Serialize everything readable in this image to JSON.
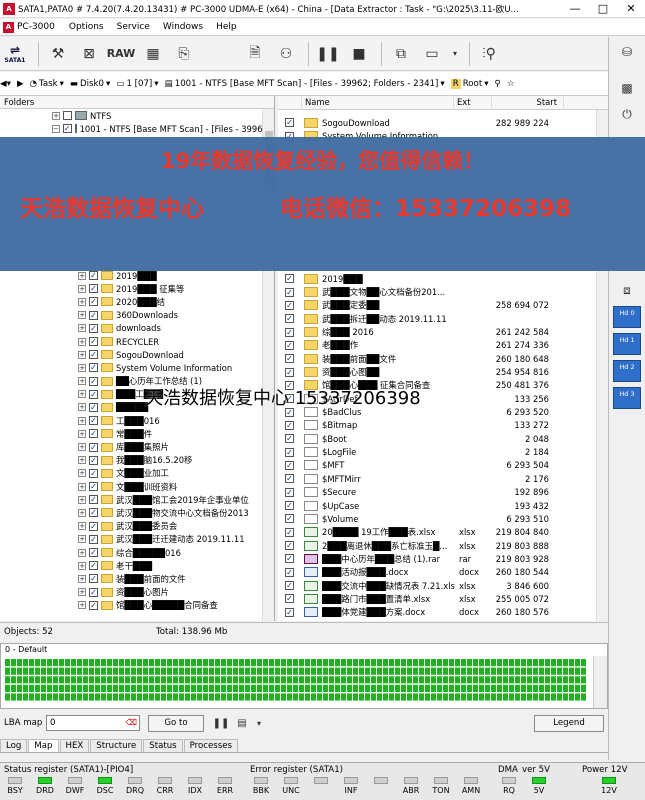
{
  "window": {
    "title": "SATA1,PATA0 # 7.4.20(7.4.20.13431) # PC-3000 UDMA-E (x64) - China - [Data Extractor : Task - \"G:\\2025\\3.11-欧U...",
    "minimize": "—",
    "maximize": "□",
    "close": "✕"
  },
  "menu": {
    "logo": "PC-3000",
    "items": [
      "Options",
      "Service",
      "Windows",
      "Help"
    ]
  },
  "toolbar": {
    "sata_label": "SATA1",
    "raw_label": "RAW"
  },
  "pathbar": {
    "task": "Task",
    "disk": "Disk0",
    "part_num": "1 [07]",
    "path": "1001 - NTFS [Base MFT Scan] - [Files - 39962; Folders - 2341]",
    "root": "Root"
  },
  "left_pane": {
    "header": "Folders",
    "tree_top": [
      {
        "indent": 52,
        "expander": "+",
        "checked": false,
        "icon": "drive",
        "label": "NTFS"
      },
      {
        "indent": 52,
        "expander": "−",
        "checked": true,
        "icon": "drive",
        "label": "1001 - NTFS [Base MFT Scan] - [Files - 39962"
      }
    ],
    "tree": [
      {
        "label": "2019███"
      },
      {
        "label": "2019███ 征集等"
      },
      {
        "label": "2020███结"
      },
      {
        "label": "360Downloads"
      },
      {
        "label": "downloads"
      },
      {
        "label": "RECYCLER"
      },
      {
        "label": "SogouDownload"
      },
      {
        "label": "System Volume Information"
      },
      {
        "label": "██心历年工作总结 (1)"
      },
      {
        "label": "███工███"
      },
      {
        "label": "█████"
      },
      {
        "label": "工███016"
      },
      {
        "label": "常███件"
      },
      {
        "label": "库███集照片"
      },
      {
        "label": "我███脑16.5.20移"
      },
      {
        "label": "文███业加工"
      },
      {
        "label": "文███训班资料"
      },
      {
        "label": "武汉███馆工会2019年企事业单位"
      },
      {
        "label": "武汉███物交流中心文档备份2013"
      },
      {
        "label": "武汉███委员会"
      },
      {
        "label": "武汉███迁迁建动态 2019.11.11"
      },
      {
        "label": "综合█████016"
      },
      {
        "label": "老干███"
      },
      {
        "label": "装███前面的文件"
      },
      {
        "label": "资███心图片"
      },
      {
        "label": "馆███心█████合同备查"
      }
    ]
  },
  "right_pane": {
    "col_name": "Name",
    "col_ext": "Ext",
    "col_start": "Start",
    "rows_top": [
      {
        "icon": "folder",
        "name": "SogouDownload",
        "ext": "",
        "start": "282 989 224"
      },
      {
        "icon": "folder",
        "name": "System Volume Information",
        "ext": "",
        "start": ""
      }
    ],
    "rows": [
      {
        "icon": "folder",
        "name": "2019███",
        "ext": "",
        "start": ""
      },
      {
        "icon": "folder",
        "name": "武███文物██心文档备份201...",
        "ext": "",
        "start": ""
      },
      {
        "icon": "folder",
        "name": "武███定委██",
        "ext": "",
        "start": "258 694 072"
      },
      {
        "icon": "folder",
        "name": "武███拆迁██动态 2019.11.11",
        "ext": "",
        "start": ""
      },
      {
        "icon": "folder",
        "name": "综███ 2016",
        "ext": "",
        "start": "261 242 584"
      },
      {
        "icon": "folder",
        "name": "老███作",
        "ext": "",
        "start": "261 274 336"
      },
      {
        "icon": "folder",
        "name": "装███前面██文件",
        "ext": "",
        "start": "260 180 648"
      },
      {
        "icon": "folder",
        "name": "资███心图██",
        "ext": "",
        "start": "254 954 816"
      },
      {
        "icon": "folder",
        "name": "馆███心███ 征集合同备查",
        "ext": "",
        "start": "250 481 376"
      },
      {
        "icon": "file",
        "name": "$AttrDef",
        "ext": "",
        "start": "133 256"
      },
      {
        "icon": "file",
        "name": "$BadClus",
        "ext": "",
        "start": "6 293 520"
      },
      {
        "icon": "file",
        "name": "$Bitmap",
        "ext": "",
        "start": "133 272"
      },
      {
        "icon": "file",
        "name": "$Boot",
        "ext": "",
        "start": "2 048"
      },
      {
        "icon": "file",
        "name": "$LogFile",
        "ext": "",
        "start": "2 184"
      },
      {
        "icon": "file",
        "name": "$MFT",
        "ext": "",
        "start": "6 293 504"
      },
      {
        "icon": "file",
        "name": "$MFTMirr",
        "ext": "",
        "start": "2 176"
      },
      {
        "icon": "file",
        "name": "$Secure",
        "ext": "",
        "start": "192 896"
      },
      {
        "icon": "file",
        "name": "$UpCase",
        "ext": "",
        "start": "193 432"
      },
      {
        "icon": "file",
        "name": "$Volume",
        "ext": "",
        "start": "6 293 510"
      },
      {
        "icon": "xls",
        "name": "20████ 19工作███表.xlsx",
        "ext": "xlsx",
        "start": "219 804 840"
      },
      {
        "icon": "xls",
        "name": "2███离退休███系亡标准玉█...",
        "ext": "xlsx",
        "start": "219 803 888"
      },
      {
        "icon": "rar",
        "name": "███中心历年███总结 (1).rar",
        "ext": "rar",
        "start": "219 803 928"
      },
      {
        "icon": "doc",
        "name": "███活动报███.docx",
        "ext": "docx",
        "start": "260 180 544"
      },
      {
        "icon": "xls",
        "name": "███交流中███缺情况表 7.21.xlsx",
        "ext": "xlsx",
        "start": "3 846 600"
      },
      {
        "icon": "xls",
        "name": "███路门市███置清单.xlsx",
        "ext": "xlsx",
        "start": "255 005 072"
      },
      {
        "icon": "doc",
        "name": "███体党建███方案.docx",
        "ext": "docx",
        "start": "260 180 576"
      }
    ]
  },
  "status": {
    "objects": "Objects: 52",
    "total": "Total: 138.96 Mb"
  },
  "map": {
    "title": "0 - Default"
  },
  "lba": {
    "label": "LBA map",
    "value": "0",
    "goto": "Go to",
    "legend": "Legend"
  },
  "tabs": [
    "Log",
    "Map",
    "HEX",
    "Structure",
    "Status",
    "Processes"
  ],
  "active_tab": "Map",
  "registers": {
    "status_title": "Status register (SATA1)-[PIO4]",
    "error_title": "Error register (SATA1)",
    "dma_title": "DMA",
    "ver_title": "ver 5V",
    "power_title": "Power 12V",
    "status_bits": [
      {
        "label": "BSY",
        "on": false
      },
      {
        "label": "DRD",
        "on": true
      },
      {
        "label": "DWF",
        "on": false
      },
      {
        "label": "DSC",
        "on": true
      },
      {
        "label": "DRQ",
        "on": false
      },
      {
        "label": "CRR",
        "on": false
      },
      {
        "label": "IDX",
        "on": false
      },
      {
        "label": "ERR",
        "on": false
      }
    ],
    "error_bits": [
      {
        "label": "BBK",
        "on": false
      },
      {
        "label": "UNC",
        "on": false
      },
      {
        "label": "",
        "on": false
      },
      {
        "label": "INF",
        "on": false
      },
      {
        "label": "",
        "on": false
      },
      {
        "label": "ABR",
        "on": false
      },
      {
        "label": "TON",
        "on": false
      },
      {
        "label": "AMN",
        "on": false
      }
    ],
    "dma_bit": {
      "label": "RQ",
      "on": false
    },
    "ver_bit": {
      "label": "5V",
      "on": true
    },
    "power_bit": {
      "label": "12V",
      "on": true
    }
  },
  "hd_buttons": [
    "Hd 0",
    "Hd 1",
    "Hd 2",
    "Hd 3"
  ],
  "overlay": {
    "line1": "19年数据恢复经验，您值得信赖！",
    "line2a": "天浩数据恢复中心",
    "line2b": "电话微信：15337206398",
    "watermark": "天浩数据恢复中心 15337206398"
  },
  "colors": {
    "map_green": "#22b022",
    "led_on": "#27d12c",
    "banner_bg": "#3e6aa0",
    "banner_text": "#e83a2e",
    "hd_button": "#2f6fc9"
  }
}
